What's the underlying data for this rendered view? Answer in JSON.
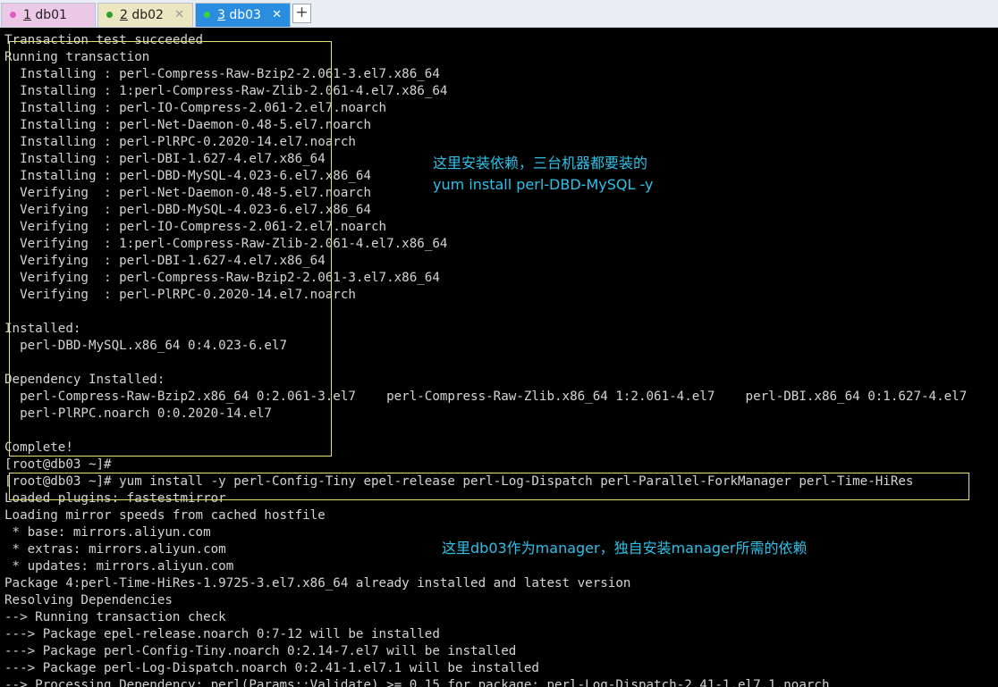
{
  "tabs": [
    {
      "num": "1",
      "name": " db01",
      "dot_color": "#e05bc4",
      "active": false
    },
    {
      "num": "2",
      "name": " db02",
      "dot_color": "#2aa12a",
      "active": false
    },
    {
      "num": "3",
      "name": " db03",
      "dot_color": "#39d639",
      "active": true
    }
  ],
  "tab_close_glyph": "✕",
  "add_tab_glyph": "+",
  "terminal": {
    "lines": [
      "Transaction test succeeded",
      "Running transaction",
      "  Installing : perl-Compress-Raw-Bzip2-2.061-3.el7.x86_64",
      "  Installing : 1:perl-Compress-Raw-Zlib-2.061-4.el7.x86_64",
      "  Installing : perl-IO-Compress-2.061-2.el7.noarch",
      "  Installing : perl-Net-Daemon-0.48-5.el7.noarch",
      "  Installing : perl-PlRPC-0.2020-14.el7.noarch",
      "  Installing : perl-DBI-1.627-4.el7.x86_64",
      "  Installing : perl-DBD-MySQL-4.023-6.el7.x86_64",
      "  Verifying  : perl-Net-Daemon-0.48-5.el7.noarch",
      "  Verifying  : perl-DBD-MySQL-4.023-6.el7.x86_64",
      "  Verifying  : perl-IO-Compress-2.061-2.el7.noarch",
      "  Verifying  : 1:perl-Compress-Raw-Zlib-2.061-4.el7.x86_64",
      "  Verifying  : perl-DBI-1.627-4.el7.x86_64",
      "  Verifying  : perl-Compress-Raw-Bzip2-2.061-3.el7.x86_64",
      "  Verifying  : perl-PlRPC-0.2020-14.el7.noarch",
      "",
      "Installed:",
      "  perl-DBD-MySQL.x86_64 0:4.023-6.el7",
      "",
      "Dependency Installed:",
      "  perl-Compress-Raw-Bzip2.x86_64 0:2.061-3.el7    perl-Compress-Raw-Zlib.x86_64 1:2.061-4.el7    perl-DBI.x86_64 0:1.627-4.el7",
      "  perl-PlRPC.noarch 0:0.2020-14.el7",
      "",
      "Complete!",
      "[root@db03 ~]#",
      "[root@db03 ~]# yum install -y perl-Config-Tiny epel-release perl-Log-Dispatch perl-Parallel-ForkManager perl-Time-HiRes",
      "Loaded plugins: fastestmirror",
      "Loading mirror speeds from cached hostfile",
      " * base: mirrors.aliyun.com",
      " * extras: mirrors.aliyun.com",
      " * updates: mirrors.aliyun.com",
      "Package 4:perl-Time-HiRes-1.9725-3.el7.x86_64 already installed and latest version",
      "Resolving Dependencies",
      "--> Running transaction check",
      "---> Package epel-release.noarch 0:7-12 will be installed",
      "---> Package perl-Config-Tiny.noarch 0:2.14-7.el7 will be installed",
      "---> Package perl-Log-Dispatch.noarch 0:2.41-1.el7.1 will be installed",
      "--> Processing Dependency: perl(Params::Validate) >= 0.15 for package: perl-Log-Dispatch-2.41-1.el7.1.noarch"
    ]
  },
  "annotations": {
    "note1": "这里安装依赖，三台机器都要装的",
    "note2": "yum install perl-DBD-MySQL -y",
    "note3": "这里db03作为manager，独自安装manager所需的依赖",
    "color": "#2fc0e8",
    "box_color": "#e6e07a"
  }
}
